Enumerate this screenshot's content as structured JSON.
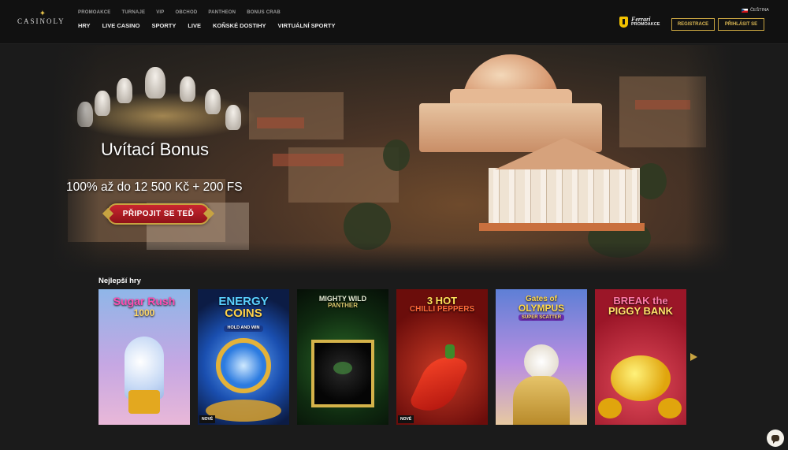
{
  "header": {
    "logo_text": "CASINOLY",
    "top_links": [
      "PROMOAKCE",
      "TURNAJE",
      "VIP",
      "OBCHOD",
      "PANTHEON",
      "BONUS CRAB"
    ],
    "main_links": [
      "HRY",
      "LIVE CASINO",
      "SPORTY",
      "LIVE",
      "KOŇSKÉ DOSTIHY",
      "VIRTUÁLNÍ SPORTY"
    ],
    "partner": {
      "brand": "Ferrari",
      "label": "PROMOAKCE"
    },
    "language": "ČEŠTINA",
    "register_label": "REGISTRACE",
    "login_label": "PŘIHLÁSIT SE"
  },
  "hero": {
    "title": "Uvítací Bonus",
    "subtitle": "100% až do 12 500 Kč + 200 FS",
    "cta_label": "PŘIPOJIT SE TEĎ"
  },
  "games": {
    "section_title": "Nejlepší hry",
    "items": [
      {
        "title": "Sugar Rush 1000",
        "title_line1": "Sugar Rush",
        "title_line2": "1000",
        "badge": ""
      },
      {
        "title": "Energy Coins",
        "title_line1": "ENERGY",
        "title_line2": "COINS",
        "tag": "HOLD AND WIN",
        "badge": "NOVÉ"
      },
      {
        "title": "Mighty Wild Panther",
        "title_line1": "MIGHTY WILD",
        "title_line2": "PANTHER",
        "badge": ""
      },
      {
        "title": "3 Hot Chilli Peppers",
        "title_line1": "3 HOT",
        "title_line2": "CHILLI PEPPERS",
        "badge": "NOVÉ"
      },
      {
        "title": "Gates of Olympus Super Scatter",
        "title_line1": "Gates of",
        "title_line2": "OLYMPUS",
        "tag": "SUPER SCATTER",
        "badge": ""
      },
      {
        "title": "Break the Piggy Bank",
        "title_line1": "BREAK the",
        "title_line2": "PIGGY BANK",
        "badge": ""
      }
    ]
  },
  "colors": {
    "gold": "#c7a341",
    "cta_red": "#c92630",
    "header_bg": "#111111",
    "page_bg": "#1b1b1b"
  },
  "icons": [
    "ferrari-logo-icon",
    "czech-flag-icon",
    "next-arrow-icon",
    "chat-icon"
  ]
}
